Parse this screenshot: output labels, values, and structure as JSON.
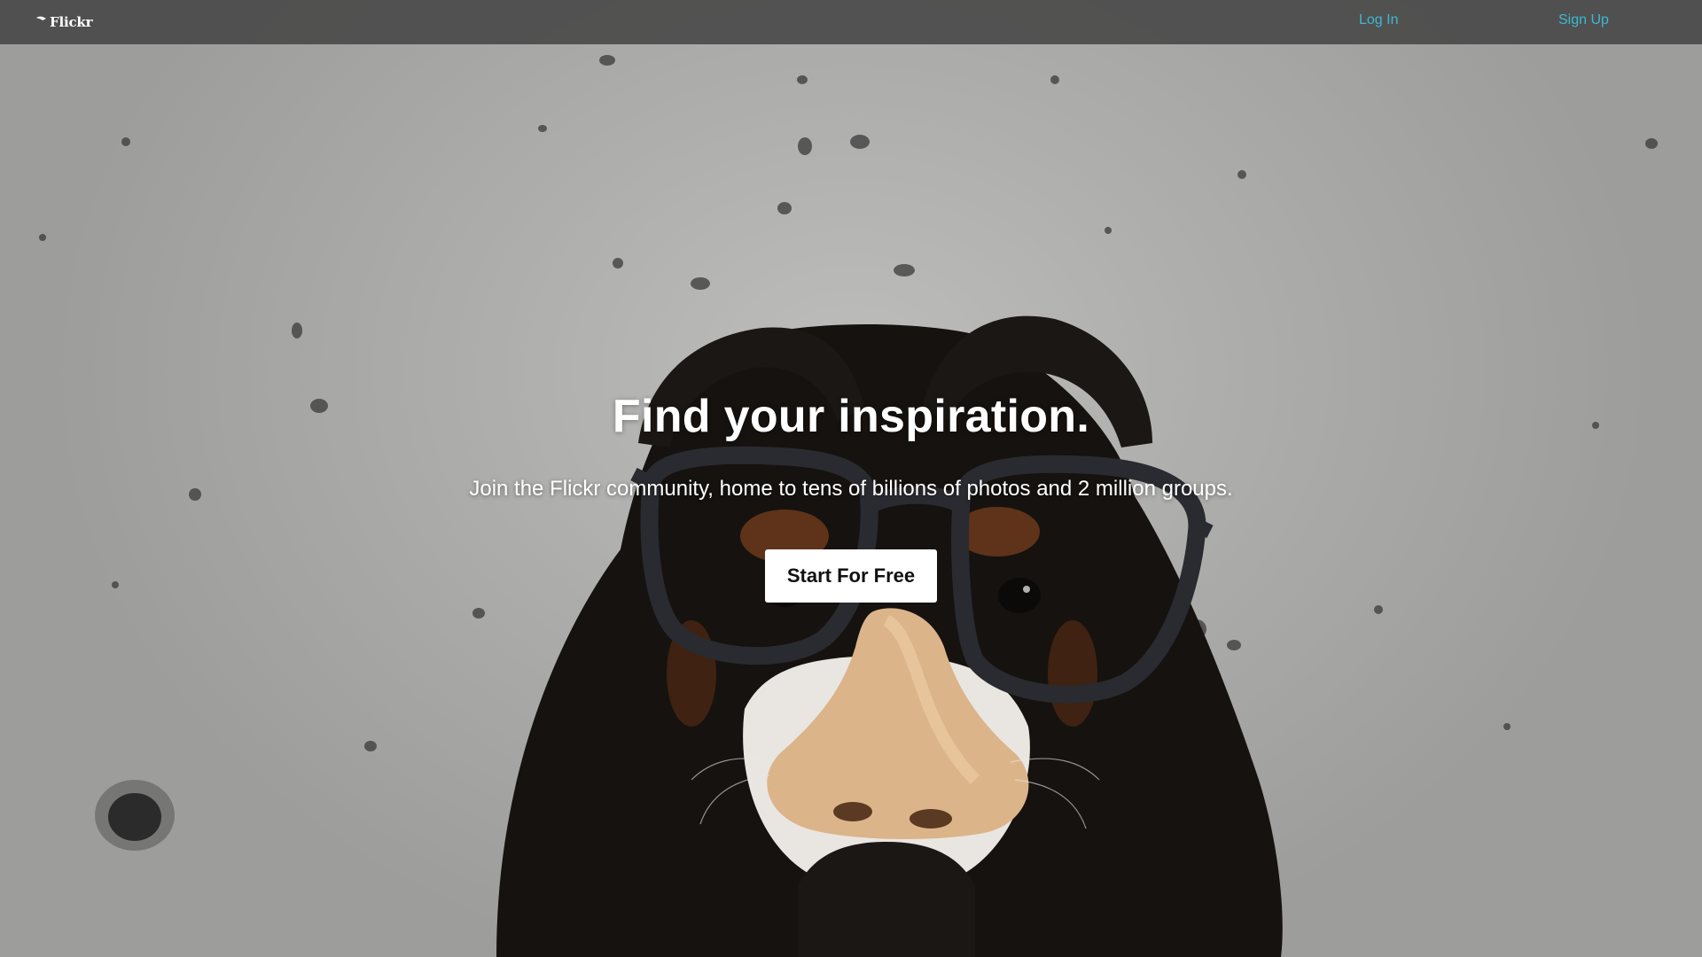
{
  "header": {
    "logo_text": "Flickr",
    "login_label": "Log In",
    "signup_label": "Sign Up"
  },
  "hero": {
    "title": "Find your inspiration.",
    "subtitle": "Join the Flickr community, home to tens of billions of photos and 2 million groups.",
    "cta_label": "Start For Free"
  },
  "colors": {
    "topbar_bg": "#464646",
    "link": "#3db8d2",
    "cta_bg": "#ffffff",
    "cta_text": "#111111"
  },
  "icons": [
    "flickr-logo-icon"
  ]
}
